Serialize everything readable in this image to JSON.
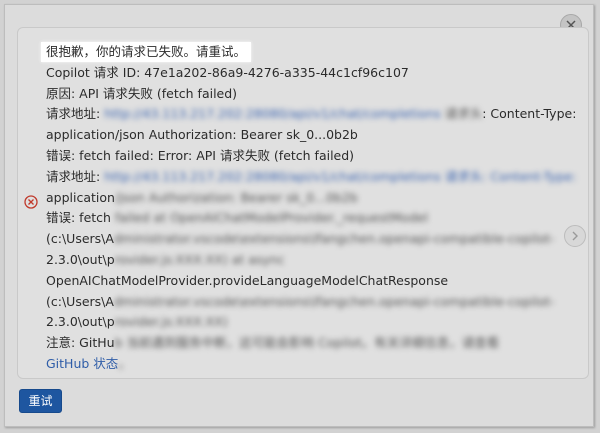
{
  "message": {
    "title": "很抱歉，你的请求已失败。请重试。",
    "request_id_label": "Copilot 请求 ID: 47e1a202-86a9-4276-a335-44c1cf96c107",
    "reason": "原因: API 请求失败 (fetch failed)",
    "request_url_label": "请求地址: ",
    "request_url_blurred": "http://43.113.217.202:28080/api/v1/chat/completions",
    "request_header_blurred": "请求头",
    "content_type_suffix": ": Content-Type:",
    "auth_line": "application/json Authorization: Bearer sk_0...0b2b",
    "error_line": "错误: fetch failed: Error: API 请求失败 (fetch failed)",
    "request_url_label_2": "请求地址: ",
    "request_url_blurred_2": "http://43.113.217.202:28080/api/v1/chat/completions 请求头: Content-Type:",
    "app_prefix": "application",
    "app_blurred": "/json Authorization: Bearer sk_0...0b2b",
    "error_prefix_2": "错误: fetch ",
    "error_blurred_2": "failed at OpenAIChatModelProvider._requestModel",
    "path_prefix_1": "(c:\\Users\\A",
    "path_blurred_1": "dministrator.vscode\\extensions\\lfangchen.openapi-compatible-copilot-",
    "version_prefix_1": "2.3.0\\out\\p",
    "version_blurred_1": "rovider.js:XXX:XX) at async",
    "provider_line": "OpenAIChatModelProvider.provideLanguageModelChatResponse",
    "path_prefix_2": "(c:\\Users\\A",
    "path_blurred_2": "dministrator.vscode\\extensions\\lfangchen.openapi-compatible-copilot-",
    "version_prefix_2": "2.3.0\\out\\p",
    "version_blurred_2": "rovider.js:XXX:XX)",
    "note_prefix": "注意: GitHu",
    "note_blurred": "b 当前遇到服务中断，这可能会影响 Copilot。有关详细信息，请查看",
    "github_status_link": "GitHub 状态",
    "github_status_tail": "。"
  },
  "buttons": {
    "retry_label": "重试"
  },
  "icons": {
    "close": "close-icon",
    "error": "error-circle-icon",
    "next": "chevron-right-icon"
  },
  "colors": {
    "accent": "#1e56a0",
    "error": "#c0392b",
    "link": "#2f5da8"
  }
}
